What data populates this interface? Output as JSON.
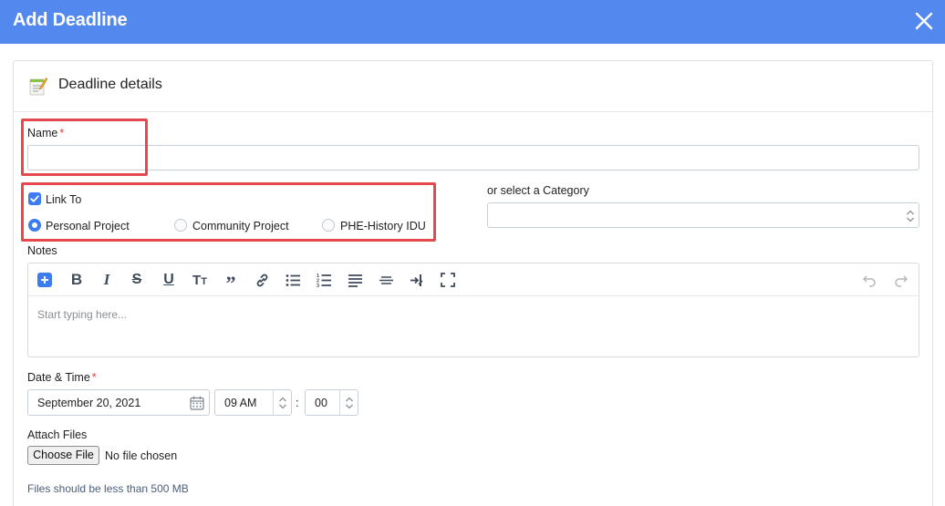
{
  "dialog": {
    "title": "Add Deadline",
    "close_icon": "close-icon"
  },
  "card": {
    "heading": "Deadline details",
    "heading_icon": "memo-icon"
  },
  "name_field": {
    "label": "Name",
    "required_mark": "*",
    "value": ""
  },
  "link_to": {
    "label": "Link To",
    "checked": true,
    "options": [
      {
        "label": "Personal Project",
        "selected": true
      },
      {
        "label": "Community Project",
        "selected": false
      },
      {
        "label": "PHE-History IDU",
        "selected": false
      }
    ]
  },
  "category": {
    "label": "or select a Category",
    "value": ""
  },
  "notes": {
    "label": "Notes",
    "placeholder": "Start typing here...",
    "toolbar": [
      "plus-icon",
      "bold-icon",
      "italic-icon",
      "strikethrough-icon",
      "underline-icon",
      "text-size-icon",
      "quote-icon",
      "link-icon",
      "bullet-list-icon",
      "numbered-list-icon",
      "align-icon",
      "horizontal-rule-icon",
      "indent-icon",
      "fullscreen-icon",
      "undo-icon",
      "redo-icon"
    ]
  },
  "datetime": {
    "label": "Date & Time",
    "required_mark": "*",
    "date": "September 20, 2021",
    "hour": "09 AM",
    "separator": ":",
    "minute": "00"
  },
  "attach": {
    "label": "Attach Files",
    "button": "Choose File",
    "status": "No file chosen",
    "hint": "Files should be less than 500 MB"
  },
  "colors": {
    "header": "#5389ee",
    "accent": "#3d7cf0",
    "highlight": "#e5484d",
    "required": "#e53935"
  }
}
